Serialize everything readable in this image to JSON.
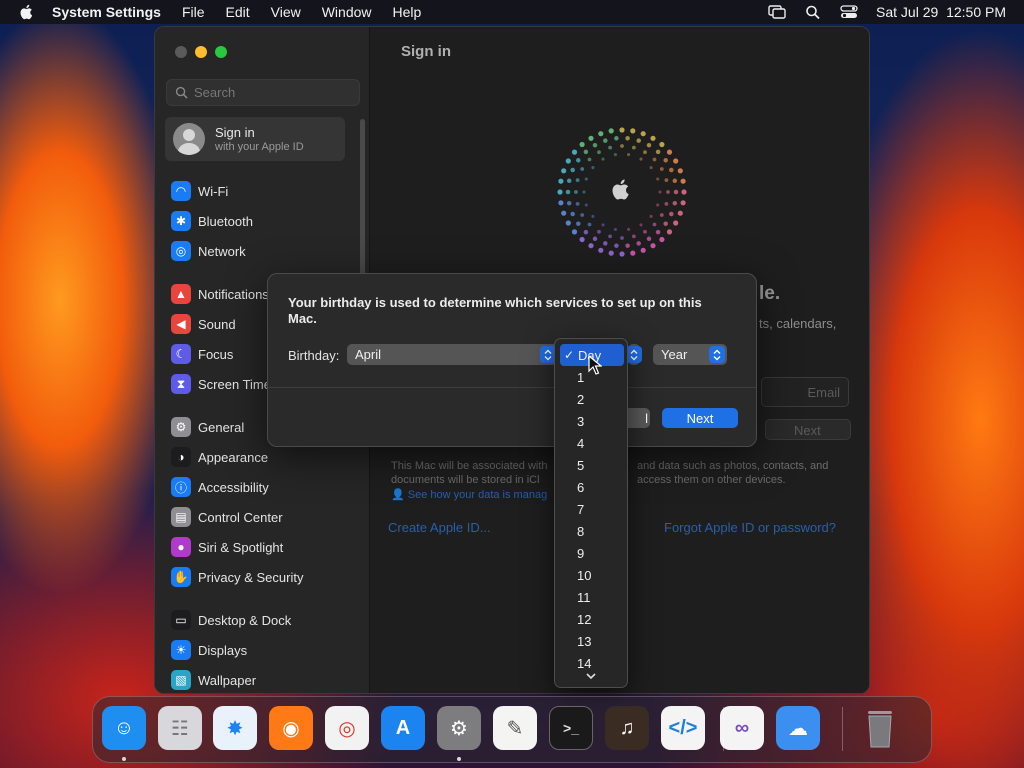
{
  "menubar": {
    "app_name": "System Settings",
    "items": [
      "File",
      "Edit",
      "View",
      "Window",
      "Help"
    ],
    "datetime": "Sat Jul 29  12:50 PM"
  },
  "sidebar": {
    "search_placeholder": "Search",
    "signin": {
      "title": "Sign in",
      "subtitle": "with your Apple ID"
    },
    "items": [
      {
        "label": "Wi-Fi",
        "icon": "wifi-icon",
        "color": "#1a7cf5"
      },
      {
        "label": "Bluetooth",
        "icon": "bluetooth-icon",
        "color": "#1a7cf5"
      },
      {
        "label": "Network",
        "icon": "globe-icon",
        "color": "#1a7cf5"
      },
      {
        "label": "Notifications",
        "icon": "bell-icon",
        "color": "#e8453c"
      },
      {
        "label": "Sound",
        "icon": "speaker-icon",
        "color": "#e8453c"
      },
      {
        "label": "Focus",
        "icon": "moon-icon",
        "color": "#5e5ce6"
      },
      {
        "label": "Screen Time",
        "icon": "hourglass-icon",
        "color": "#5e5ce6"
      },
      {
        "label": "General",
        "icon": "gear-icon",
        "color": "#8e8e93"
      },
      {
        "label": "Appearance",
        "icon": "appearance-icon",
        "color": "#1c1c1e"
      },
      {
        "label": "Accessibility",
        "icon": "accessibility-icon",
        "color": "#1a7cf5"
      },
      {
        "label": "Control Center",
        "icon": "control-center-icon",
        "color": "#8e8e93"
      },
      {
        "label": "Siri & Spotlight",
        "icon": "siri-icon",
        "color": "#b03ac9"
      },
      {
        "label": "Privacy & Security",
        "icon": "hand-icon",
        "color": "#1a7cf5"
      },
      {
        "label": "Desktop & Dock",
        "icon": "dock-icon",
        "color": "#1c1c1e"
      },
      {
        "label": "Displays",
        "icon": "sun-icon",
        "color": "#1a7cf5"
      },
      {
        "label": "Wallpaper",
        "icon": "wallpaper-icon",
        "color": "#2aa5c8"
      }
    ]
  },
  "main": {
    "title": "Sign in",
    "bg_heading_tail": "le.",
    "bg_sub_tail": "ts, calendars,",
    "email_placeholder": "Email",
    "next_disabled": "Next",
    "fine_print_1": "This Mac will be associated with",
    "fine_print_1b": "and data such as photos, contacts, and",
    "fine_print_2": "documents will be stored in iCl",
    "fine_print_2b": "access them on other devices.",
    "fine_print_3": "See how your data is manag",
    "create_link": "Create Apple ID...",
    "forgot_link": "Forgot Apple ID or password?"
  },
  "dialog": {
    "message": "Your birthday is used to determine which services to set up on this Mac.",
    "birthday_label": "Birthday:",
    "month_value": "April",
    "year_value": "Year",
    "cancel_label": "l",
    "next_label": "Next"
  },
  "day_dropdown": {
    "selected": "Day",
    "options": [
      "1",
      "2",
      "3",
      "4",
      "5",
      "6",
      "7",
      "8",
      "9",
      "10",
      "11",
      "12",
      "13",
      "14"
    ]
  },
  "dock": {
    "apps": [
      {
        "name": "finder",
        "color": "#1e8ef0"
      },
      {
        "name": "launchpad",
        "color": "#d8d8dc"
      },
      {
        "name": "safari",
        "color": "#e9f2fb"
      },
      {
        "name": "firefox",
        "color": "#ff7a17"
      },
      {
        "name": "chrome",
        "color": "#f2f2f2"
      },
      {
        "name": "app-store",
        "color": "#1b84f0"
      },
      {
        "name": "system-settings",
        "color": "#7d7d80"
      },
      {
        "name": "textedit",
        "color": "#f4f4f2"
      },
      {
        "name": "terminal",
        "color": "#1a1a1a"
      },
      {
        "name": "garageband",
        "color": "#3a2c22"
      },
      {
        "name": "vscode",
        "color": "#f4f4f4"
      },
      {
        "name": "visual-studio",
        "color": "#f4f4f4"
      },
      {
        "name": "weather",
        "color": "#3b8ff0"
      },
      {
        "name": "trash",
        "color": "#8a8a8e"
      }
    ]
  }
}
